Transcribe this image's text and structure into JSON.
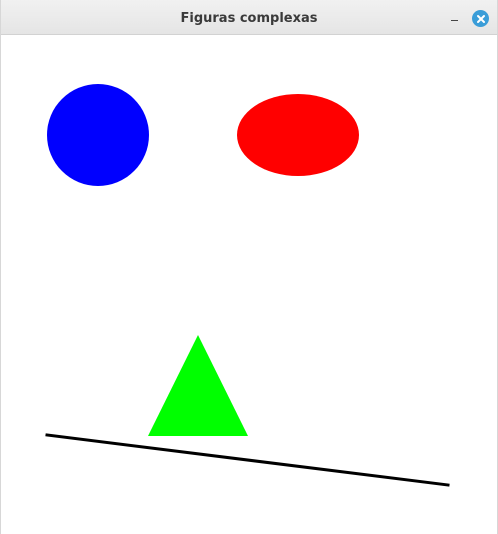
{
  "window": {
    "title": "Figuras complexas"
  },
  "controls": {
    "minimize": {
      "icon": "minimize-icon"
    },
    "close": {
      "icon": "close-icon",
      "color": "#3a9dd8"
    }
  },
  "drawing": {
    "background": "#ffffff",
    "shapes": [
      {
        "name": "circle",
        "color": "#0000ff"
      },
      {
        "name": "ellipse",
        "color": "#ff0000"
      },
      {
        "name": "triangle",
        "color": "#00ff00"
      },
      {
        "name": "line",
        "color": "#000000"
      }
    ]
  }
}
